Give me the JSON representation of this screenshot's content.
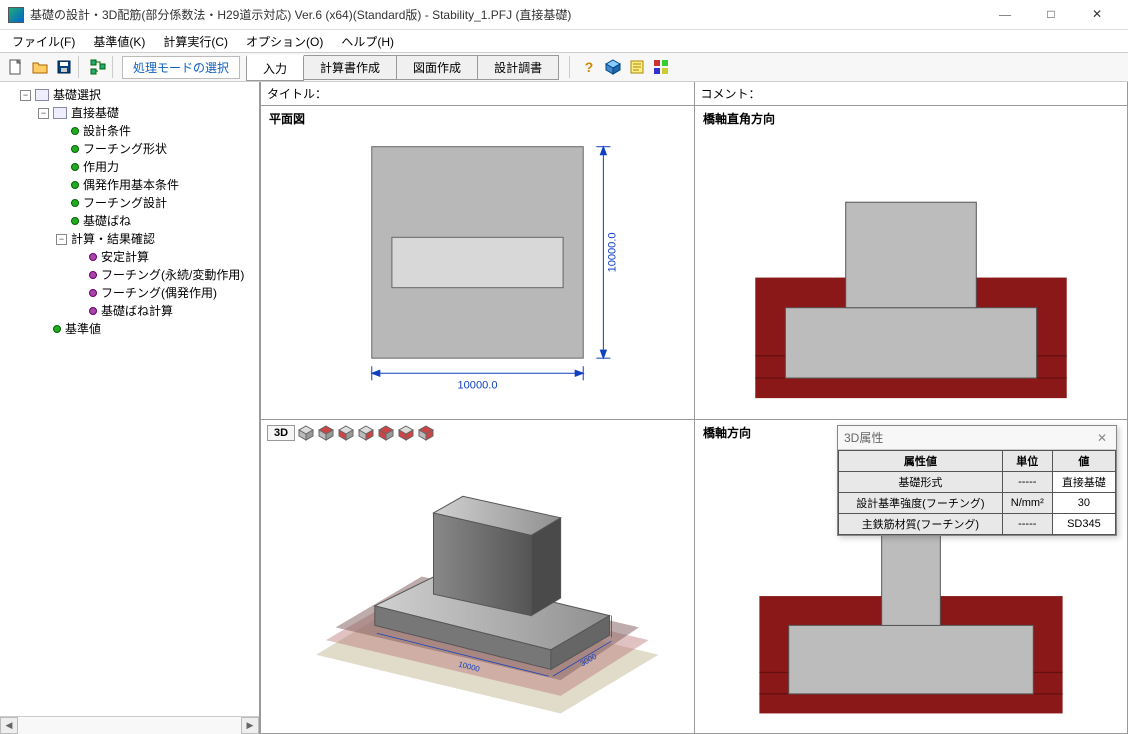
{
  "window": {
    "title": "基礎の設計・3D配筋(部分係数法・H29道示対応) Ver.6 (x64)(Standard版) - Stability_1.PFJ (直接基礎)"
  },
  "menu": {
    "file": "ファイル(F)",
    "base": "基準値(K)",
    "calc": "計算実行(C)",
    "option": "オプション(O)",
    "help": "ヘルプ(H)"
  },
  "toolbar": {
    "mode_label": "処理モードの選択",
    "tabs": {
      "input": "入力",
      "calcdoc": "計算書作成",
      "drawing": "図面作成",
      "design": "設計調書"
    }
  },
  "headers": {
    "title": "タイトル：",
    "comment": "コメント："
  },
  "tree": {
    "root": "基礎選択",
    "direct": "直接基礎",
    "cond": "設計条件",
    "footing": "フーチング形状",
    "force": "作用力",
    "accid": "偶発作用基本条件",
    "foot_design": "フーチング設計",
    "spring": "基礎ばね",
    "results": "計算・結果確認",
    "stability": "安定計算",
    "foot_pv": "フーチング(永続/変動作用)",
    "foot_acc": "フーチング(偶発作用)",
    "spring_calc": "基礎ばね計算",
    "stdval": "基準値"
  },
  "views": {
    "plan": "平面図",
    "ortho": "橋軸直角方向",
    "axial": "橋軸方向",
    "dim_w": "10000.0",
    "dim_h": "10000.0",
    "td_label": "3D"
  },
  "float": {
    "title": "3D属性",
    "h_attr": "属性値",
    "h_unit": "単位",
    "h_val": "値",
    "r1a": "基礎形式",
    "r1u": "-----",
    "r1v": "直接基礎",
    "r2a": "設計基準強度(フーチング)",
    "r2u": "N/mm²",
    "r2v": "30",
    "r3a": "主鉄筋材質(フーチング)",
    "r3u": "-----",
    "r3v": "SD345"
  }
}
